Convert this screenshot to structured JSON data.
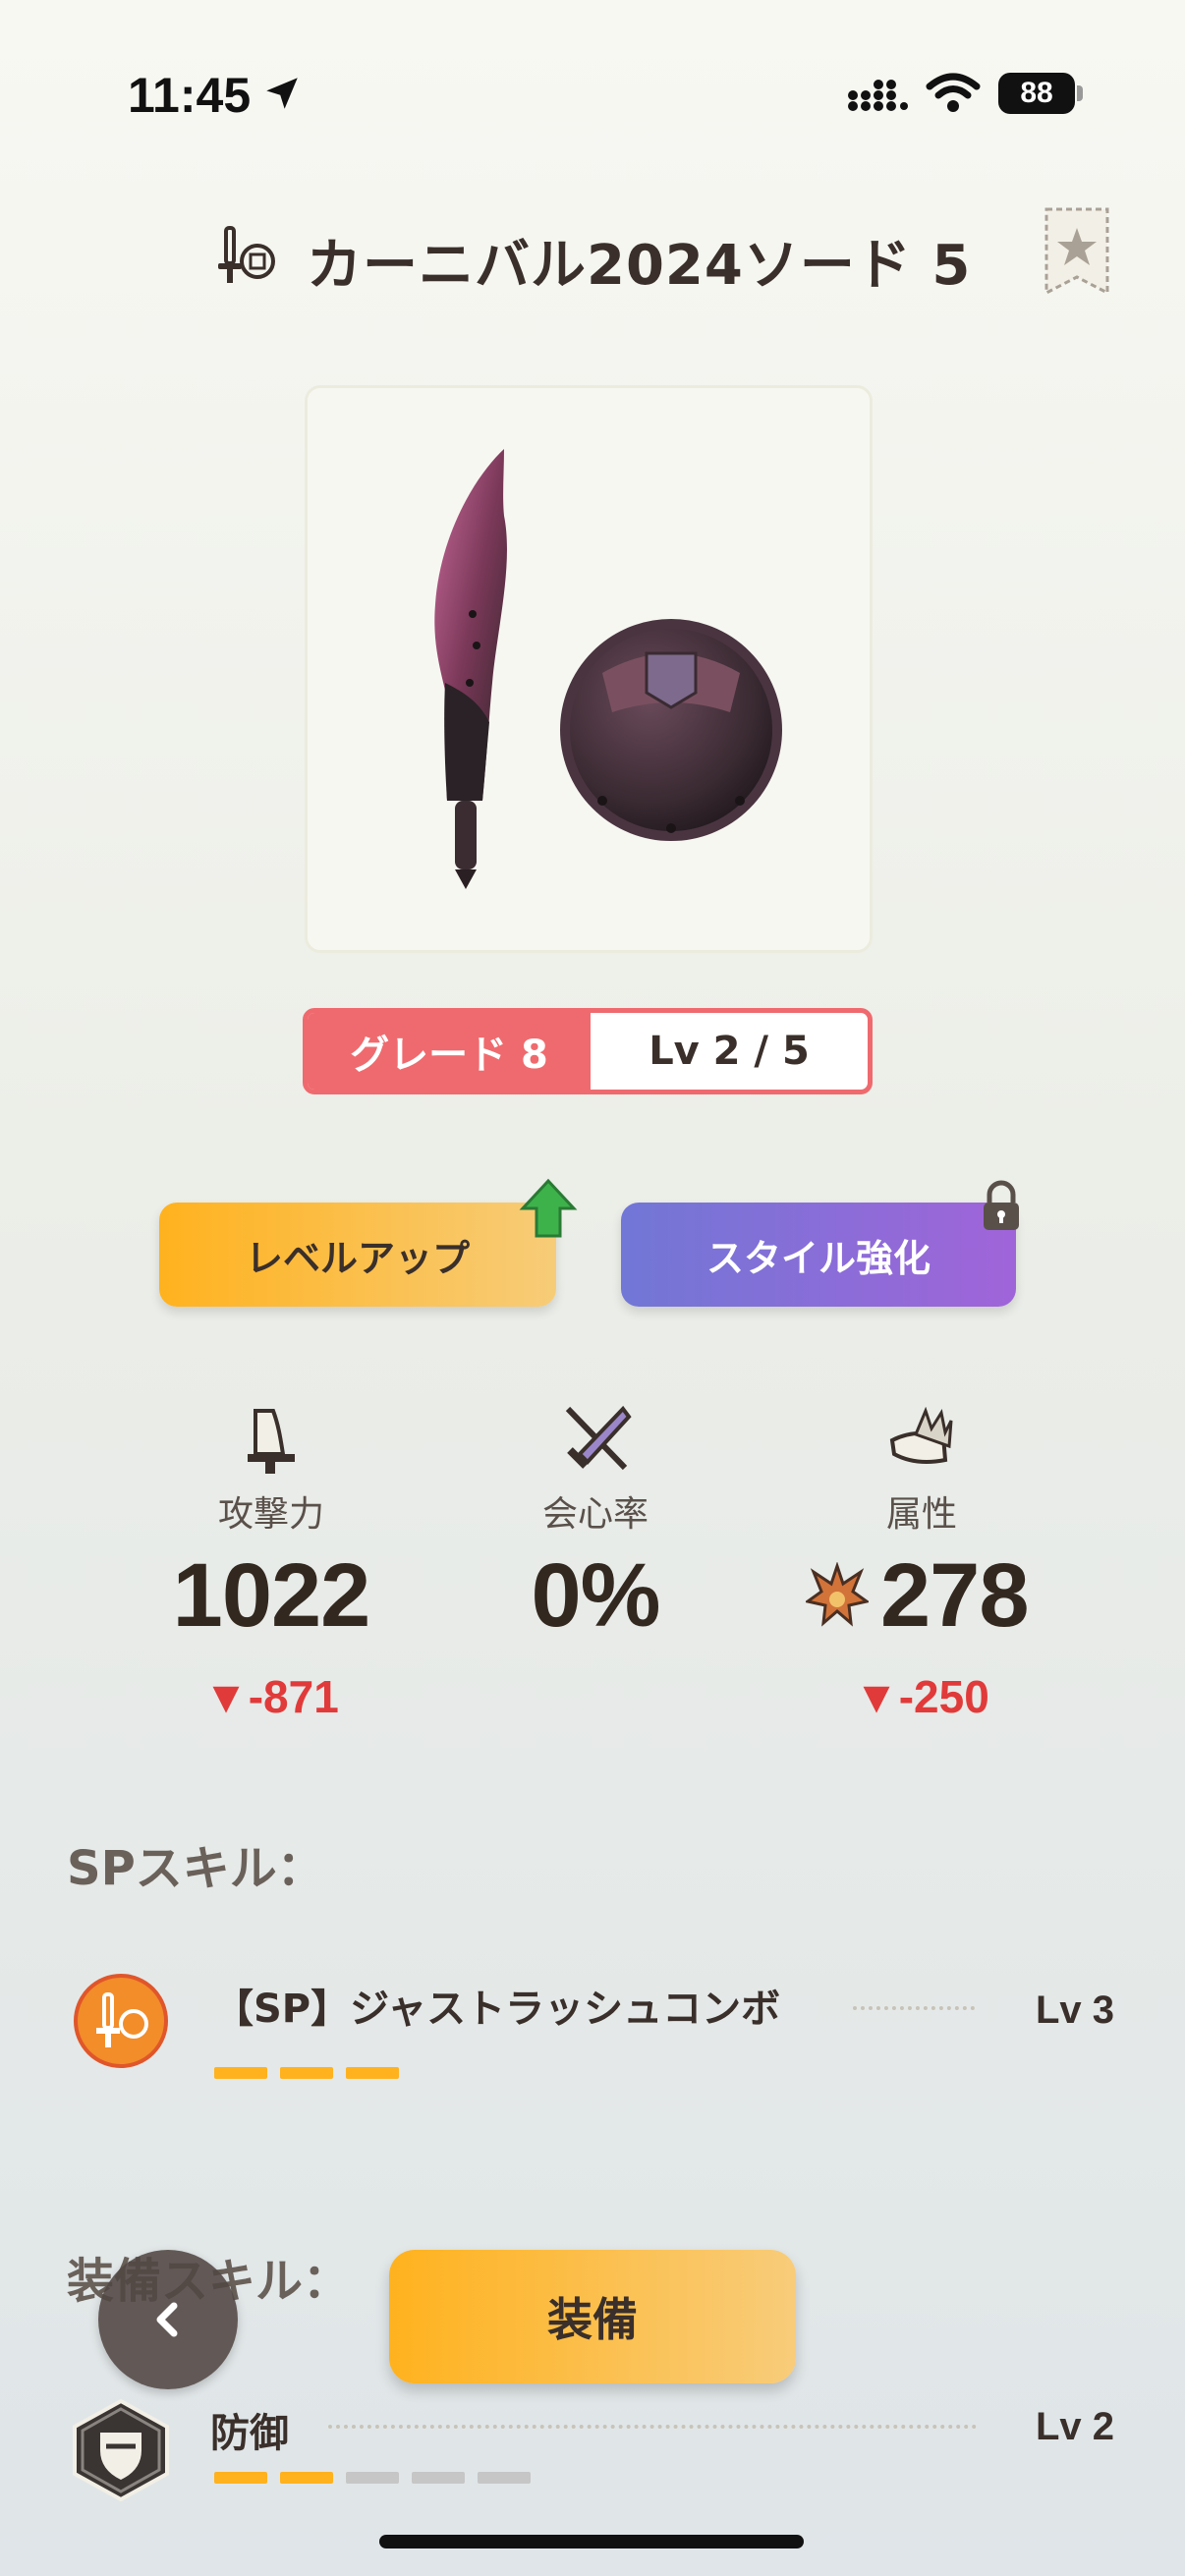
{
  "status_bar": {
    "time": "11:45",
    "battery": "88"
  },
  "header": {
    "title": "カーニバル2024ソード 5"
  },
  "grade": {
    "grade_label": "グレード 8",
    "level_label": "Lv 2 / 5"
  },
  "buttons": {
    "level_up": "レベルアップ",
    "style_enhance": "スタイル強化",
    "equip": "装備"
  },
  "stats": {
    "attack": {
      "label": "攻撃力",
      "value": "1022",
      "delta": "▼-871"
    },
    "crit": {
      "label": "会心率",
      "value": "0%"
    },
    "element": {
      "label": "属性",
      "value": "278",
      "delta": "▼-250"
    }
  },
  "sp_skills": {
    "title": "SPスキル：",
    "items": [
      {
        "name": "【SP】ジャストラッシュコンボ",
        "level": "Lv 3",
        "filled": 3,
        "total": 3
      }
    ]
  },
  "equip_skills": {
    "title": "装備スキル：",
    "items": [
      {
        "name": "防御",
        "level": "Lv 2",
        "filled": 2,
        "total": 5
      }
    ]
  },
  "colors": {
    "accent_red": "#ef6a6e",
    "accent_orange": "#ffb21e",
    "accent_purple": "#8a6ed8",
    "delta_red": "#e13a3a"
  },
  "icons": [
    "location-arrow-icon",
    "signal-icon",
    "wifi-icon",
    "sword-shield-icon",
    "bookmark-star-icon",
    "arrow-up-icon",
    "lock-icon",
    "attack-icon",
    "crit-icon",
    "element-icon",
    "blast-icon",
    "defense-icon",
    "chevron-left-icon"
  ]
}
